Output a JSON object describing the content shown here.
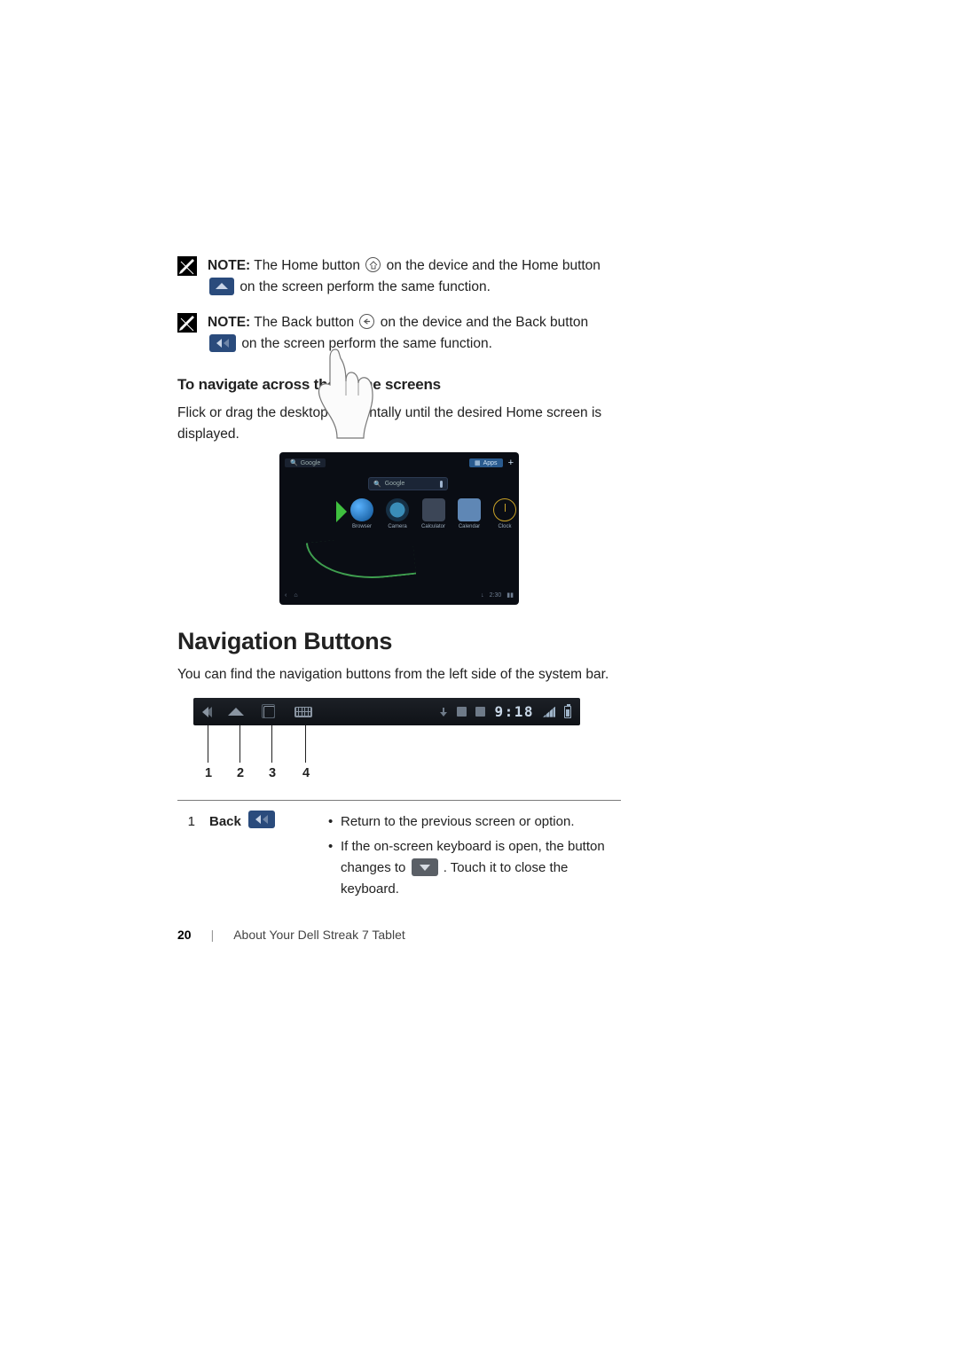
{
  "notes": {
    "note1": {
      "label": "NOTE:",
      "t1": " The Home button ",
      "t2": " on the device and the Home button ",
      "t3": " on the screen perform the same function."
    },
    "note2": {
      "label": "NOTE:",
      "t1": " The Back button ",
      "t2": " on the device and the Back button ",
      "t3": " on the screen perform the same function."
    }
  },
  "section1": {
    "heading": "To navigate across the Home screens",
    "body": "Flick or drag the desktop horizontally until the desired Home screen is displayed."
  },
  "figure1": {
    "top_search": "Google",
    "top_apps": "Apps",
    "widget_search": "Google",
    "apps": [
      "Browser",
      "Camera",
      "Calculator",
      "Calendar",
      "Clock"
    ],
    "bottom_time": "2:30"
  },
  "section2": {
    "heading": "Navigation Buttons",
    "body": "You can find the navigation buttons from the left side of the system bar."
  },
  "figure2": {
    "clock": "9:18",
    "callouts": [
      "1",
      "2",
      "3",
      "4"
    ]
  },
  "nav_table": {
    "row1": {
      "num": "1",
      "label": "Back",
      "bullets": {
        "b1": "Return to the previous screen or option.",
        "b2a": "If the on-screen keyboard is open, the button changes to ",
        "b2b": ". Touch it to close the keyboard."
      }
    }
  },
  "footer": {
    "page": "20",
    "section": "About Your Dell Streak 7 Tablet"
  }
}
